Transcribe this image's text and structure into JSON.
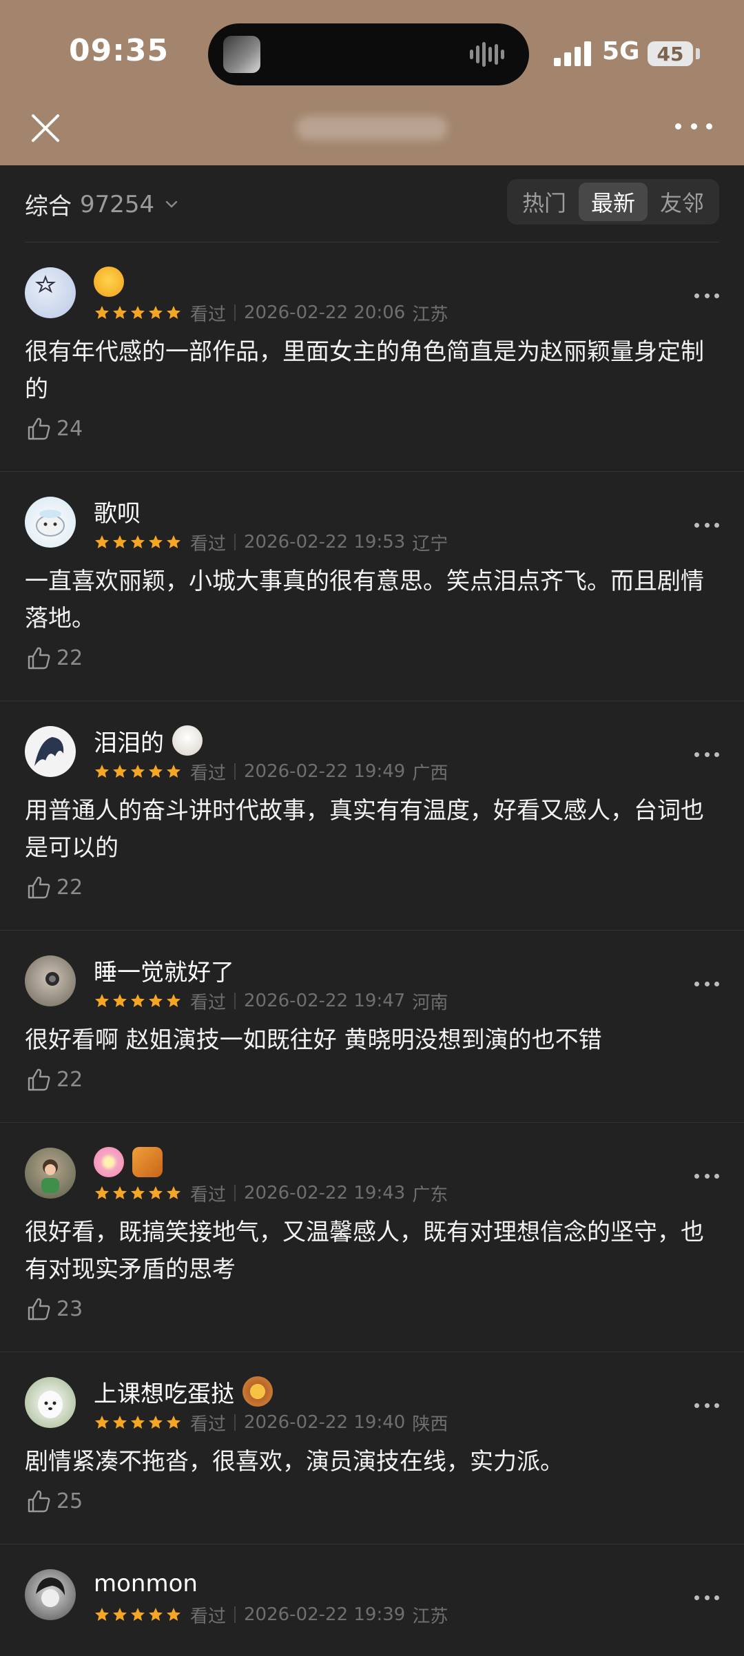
{
  "status_bar": {
    "time": "09:35",
    "network": "5G",
    "battery": "45"
  },
  "nav": {
    "close_icon": "close-icon",
    "more_icon": "more-icon"
  },
  "filter": {
    "summary_label": "综合",
    "summary_count": "97254",
    "tabs": [
      {
        "label": "热门",
        "active": false
      },
      {
        "label": "最新",
        "active": true
      },
      {
        "label": "友邻",
        "active": false
      }
    ]
  },
  "comments": [
    {
      "user": "",
      "badges": [
        "smiling-face-hearts"
      ],
      "stars": 5,
      "status": "看过",
      "datetime": "2026-02-22 20:06",
      "location": "江苏",
      "text": "很有年代感的一部作品，里面女主的角色简直是为赵丽颖量身定制的",
      "likes": "24"
    },
    {
      "user": "歌呗",
      "badges": [],
      "stars": 5,
      "status": "看过",
      "datetime": "2026-02-22 19:53",
      "location": "辽宁",
      "text": "一直喜欢丽颖，小城大事真的很有意思。笑点泪点齐飞。而且剧情落地。",
      "likes": "22"
    },
    {
      "user": "泪泪的",
      "badges": [
        "cotton"
      ],
      "stars": 5,
      "status": "看过",
      "datetime": "2026-02-22 19:49",
      "location": "广西",
      "text": "用普通人的奋斗讲时代故事，真实有有温度，好看又感人，台词也是可以的",
      "likes": "22"
    },
    {
      "user": "睡一觉就好了",
      "badges": [],
      "stars": 5,
      "status": "看过",
      "datetime": "2026-02-22 19:47",
      "location": "河南",
      "text": "很好看啊 赵姐演技一如既往好 黄晓明没想到演的也不错",
      "likes": "22"
    },
    {
      "user": "",
      "badges": [
        "cherry-blossom",
        "bear-badge"
      ],
      "stars": 5,
      "status": "看过",
      "datetime": "2026-02-22 19:43",
      "location": "广东",
      "text": "很好看，既搞笑接地气，又温馨感人，既有对理想信念的坚守，也有对现实矛盾的思考",
      "likes": "23"
    },
    {
      "user": "上课想吃蛋挞",
      "badges": [
        "egg-tart"
      ],
      "stars": 5,
      "status": "看过",
      "datetime": "2026-02-22 19:40",
      "location": "陕西",
      "text": "剧情紧凑不拖沓，很喜欢，演员演技在线，实力派。",
      "likes": "25"
    },
    {
      "user": "monmon",
      "badges": [],
      "stars": 5,
      "status": "看过",
      "datetime": "2026-02-22 19:39",
      "location": "江苏",
      "text": "",
      "likes": ""
    }
  ],
  "colors": {
    "header_bg": "#a2856c",
    "page_bg": "#222222",
    "star": "#f5a623"
  }
}
